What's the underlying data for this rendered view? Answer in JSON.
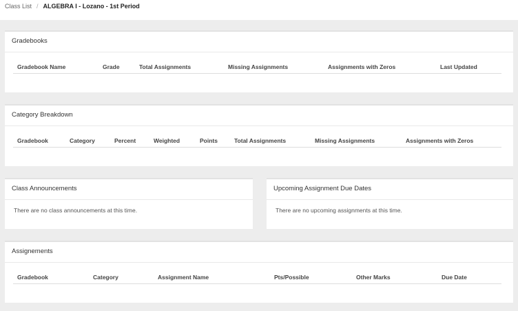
{
  "breadcrumb": {
    "class_list": "Class List",
    "separator": "/",
    "current": "ALGEBRA I - Lozano - 1st Period"
  },
  "gradebooks": {
    "title": "Gradebooks",
    "columns": [
      "Gradebook Name",
      "Grade",
      "Total Assignments",
      "Missing Assignments",
      "Assignments with Zeros",
      "Last Updated"
    ]
  },
  "category_breakdown": {
    "title": "Category Breakdown",
    "columns": [
      "Gradebook",
      "Category",
      "Percent",
      "Weighted",
      "Points",
      "Total Assignments",
      "Missing Assignments",
      "Assignments with Zeros"
    ]
  },
  "announcements": {
    "title": "Class Announcements",
    "message": "There are no class announcements at this time."
  },
  "due_dates": {
    "title": "Upcoming Assignment Due Dates",
    "message": "There are no upcoming assignments at this time."
  },
  "assignments": {
    "title": "Assignements",
    "columns": [
      "Gradebook",
      "Category",
      "Assignment Name",
      "Pts/Possible",
      "Other Marks",
      "Due Date"
    ]
  }
}
